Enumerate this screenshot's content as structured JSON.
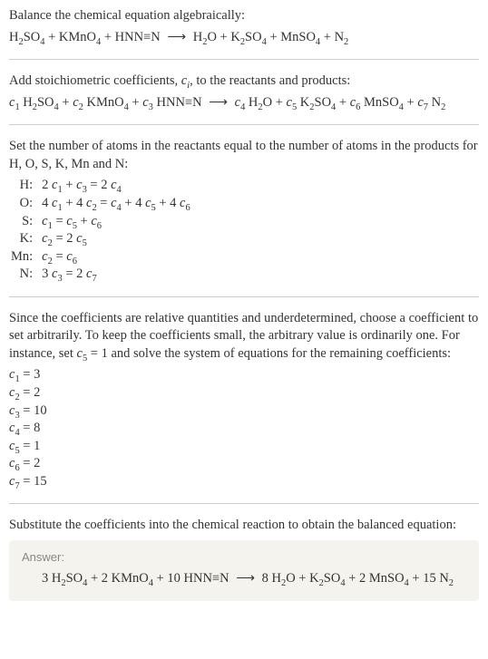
{
  "intro_line": "Balance the chemical equation algebraically:",
  "eq_unbalanced_html": "H<span class=\"sub\">2</span>SO<span class=\"sub\">4</span> + KMnO<span class=\"sub\">4</span> + HNN≡N <span class=\"arrow\">⟶</span> H<span class=\"sub\">2</span>O + K<span class=\"sub\">2</span>SO<span class=\"sub\">4</span> + MnSO<span class=\"sub\">4</span> + N<span class=\"sub\">2</span>",
  "stoich_line_html": "Add stoichiometric coefficients, <span class=\"it\">c<span class=\"sub\">i</span></span>, to the reactants and products:",
  "eq_withc_html": "<span class=\"it\">c</span><span class=\"sub\">1</span> H<span class=\"sub\">2</span>SO<span class=\"sub\">4</span> + <span class=\"it\">c</span><span class=\"sub\">2</span> KMnO<span class=\"sub\">4</span> + <span class=\"it\">c</span><span class=\"sub\">3</span> HNN≡N <span class=\"arrow\">⟶</span> <span class=\"it\">c</span><span class=\"sub\">4</span> H<span class=\"sub\">2</span>O + <span class=\"it\">c</span><span class=\"sub\">5</span> K<span class=\"sub\">2</span>SO<span class=\"sub\">4</span> + <span class=\"it\">c</span><span class=\"sub\">6</span> MnSO<span class=\"sub\">4</span> + <span class=\"it\">c</span><span class=\"sub\">7</span> N<span class=\"sub\">2</span>",
  "atoms_line": "Set the number of atoms in the reactants equal to the number of atoms in the products for H, O, S, K, Mn and N:",
  "atom_eqs": [
    {
      "label": "H:",
      "html": "2 <span class=\"it\">c</span><span class=\"sub\">1</span> + <span class=\"it\">c</span><span class=\"sub\">3</span> = 2 <span class=\"it\">c</span><span class=\"sub\">4</span>"
    },
    {
      "label": "O:",
      "html": "4 <span class=\"it\">c</span><span class=\"sub\">1</span> + 4 <span class=\"it\">c</span><span class=\"sub\">2</span> = <span class=\"it\">c</span><span class=\"sub\">4</span> + 4 <span class=\"it\">c</span><span class=\"sub\">5</span> + 4 <span class=\"it\">c</span><span class=\"sub\">6</span>"
    },
    {
      "label": "S:",
      "html": "<span class=\"it\">c</span><span class=\"sub\">1</span> = <span class=\"it\">c</span><span class=\"sub\">5</span> + <span class=\"it\">c</span><span class=\"sub\">6</span>"
    },
    {
      "label": "K:",
      "html": "<span class=\"it\">c</span><span class=\"sub\">2</span> = 2 <span class=\"it\">c</span><span class=\"sub\">5</span>"
    },
    {
      "label": "Mn:",
      "html": "<span class=\"it\">c</span><span class=\"sub\">2</span> = <span class=\"it\">c</span><span class=\"sub\">6</span>"
    },
    {
      "label": "N:",
      "html": "3 <span class=\"it\">c</span><span class=\"sub\">3</span> = 2 <span class=\"it\">c</span><span class=\"sub\">7</span>"
    }
  ],
  "since_line_html": "Since the coefficients are relative quantities and underdetermined, choose a coefficient to set arbitrarily. To keep the coefficients small, the arbitrary value is ordinarily one. For instance, set <span class=\"it\">c</span><span class=\"sub\">5</span> = 1 and solve the system of equations for the remaining coefficients:",
  "coeffs": [
    "<span class=\"it\">c</span><span class=\"sub\">1</span> = 3",
    "<span class=\"it\">c</span><span class=\"sub\">2</span> = 2",
    "<span class=\"it\">c</span><span class=\"sub\">3</span> = 10",
    "<span class=\"it\">c</span><span class=\"sub\">4</span> = 8",
    "<span class=\"it\">c</span><span class=\"sub\">5</span> = 1",
    "<span class=\"it\">c</span><span class=\"sub\">6</span> = 2",
    "<span class=\"it\">c</span><span class=\"sub\">7</span> = 15"
  ],
  "subst_line": "Substitute the coefficients into the chemical reaction to obtain the balanced equation:",
  "answer_label": "Answer:",
  "answer_html": "3 H<span class=\"sub\">2</span>SO<span class=\"sub\">4</span> + 2 KMnO<span class=\"sub\">4</span> + 10 HNN≡N <span class=\"arrow\">⟶</span> 8 H<span class=\"sub\">2</span>O + K<span class=\"sub\">2</span>SO<span class=\"sub\">4</span> + 2 MnSO<span class=\"sub\">4</span> + 15 N<span class=\"sub\">2</span>",
  "chart_data": {
    "type": "table",
    "title": "Balanced chemical equation coefficients",
    "species": [
      "H2SO4",
      "KMnO4",
      "HNN≡N",
      "H2O",
      "K2SO4",
      "MnSO4",
      "N2"
    ],
    "role": [
      "reactant",
      "reactant",
      "reactant",
      "product",
      "product",
      "product",
      "product"
    ],
    "coefficients": [
      3,
      2,
      10,
      8,
      1,
      2,
      15
    ],
    "atom_balance": {
      "H": "2 c1 + c3 = 2 c4",
      "O": "4 c1 + 4 c2 = c4 + 4 c5 + 4 c6",
      "S": "c1 = c5 + c6",
      "K": "c2 = 2 c5",
      "Mn": "c2 = c6",
      "N": "3 c3 = 2 c7"
    }
  }
}
